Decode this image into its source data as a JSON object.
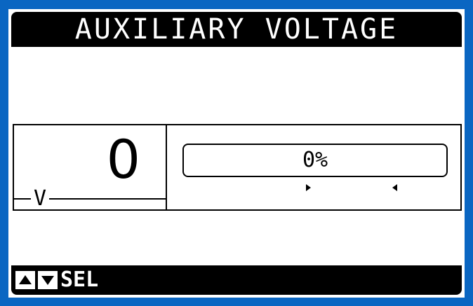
{
  "header": {
    "title": "AUXILIARY VOLTAGE"
  },
  "measurement": {
    "value": "0",
    "unit": "V"
  },
  "level_bar": {
    "label": "0%",
    "level_percent": 0
  },
  "footer": {
    "up_icon": "arrow-up-icon",
    "down_icon": "arrow-down-icon",
    "sel_label": "SEL"
  },
  "colors": {
    "bezel": "#0a66c2",
    "background": "#ffffff",
    "foreground": "#000000"
  }
}
